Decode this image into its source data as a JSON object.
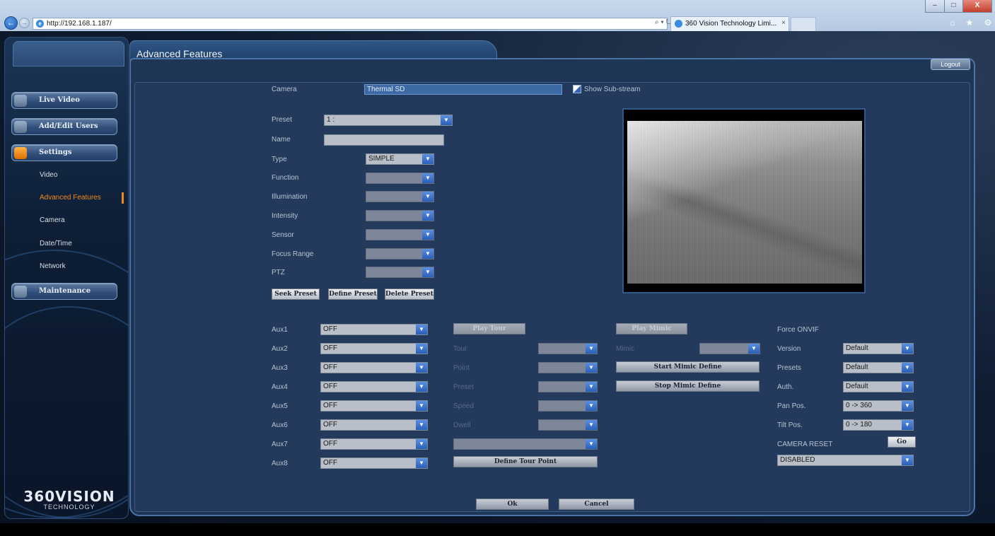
{
  "browser": {
    "url": "http://192.168.1.187/",
    "search_controls": "⌕ ▾ ↻",
    "tab_title": "360 Vision Technology Limi...",
    "tab_close": "×",
    "window_buttons": {
      "min": "–",
      "max": "□",
      "close": "X"
    },
    "toolbar_icons": "⌂ ★ ⚙"
  },
  "sidebar": {
    "menu": [
      {
        "label": "Live Video",
        "icon": "camera-icon"
      },
      {
        "label": "Add/Edit Users",
        "icon": "users-icon"
      },
      {
        "label": "Settings",
        "icon": "settings-icon"
      },
      {
        "label": "Maintenance",
        "icon": "maintenance-icon"
      }
    ],
    "settings_items": [
      "Video",
      "Advanced Features",
      "Camera",
      "Date/Time",
      "Network"
    ],
    "active_item": "Advanced Features",
    "logo_main": "360VISION",
    "logo_sub": "TECHNOLOGY"
  },
  "header": {
    "title": "Advanced Features",
    "logout": "Logout"
  },
  "camera": {
    "label": "Camera",
    "value": "Thermal SD",
    "substream_label": "Show Sub-stream"
  },
  "preset": {
    "preset_label": "Preset",
    "preset_value": "1 :",
    "name_label": "Name",
    "name_value": "",
    "type_label": "Type",
    "type_value": "SIMPLE",
    "function_label": "Function",
    "illumination_label": "Illumination",
    "intensity_label": "Intensity",
    "sensor_label": "Sensor",
    "focus_label": "Focus Range",
    "ptz_label": "PTZ",
    "seek": "Seek Preset",
    "define": "Define Preset",
    "delete": "Delete Preset"
  },
  "aux": [
    {
      "label": "Aux1",
      "value": "OFF"
    },
    {
      "label": "Aux2",
      "value": "OFF"
    },
    {
      "label": "Aux3",
      "value": "OFF"
    },
    {
      "label": "Aux4",
      "value": "OFF"
    },
    {
      "label": "Aux5",
      "value": "OFF"
    },
    {
      "label": "Aux6",
      "value": "OFF"
    },
    {
      "label": "Aux7",
      "value": "OFF"
    },
    {
      "label": "Aux8",
      "value": "OFF"
    }
  ],
  "tour": {
    "play": "Play Tour",
    "tour_label": "Tour",
    "point_label": "Point",
    "preset_label": "Preset",
    "speed_label": "Speed",
    "dwell_label": "Dwell",
    "define_point": "Define Tour Point"
  },
  "mimic": {
    "play": "Play Mimic",
    "mimic_label": "Mimic",
    "start": "Start Mimic Define",
    "stop": "Stop Mimic Define"
  },
  "onvif": {
    "title": "Force ONVIF",
    "version_label": "Version",
    "version_value": "Default",
    "presets_label": "Presets",
    "presets_value": "Default",
    "auth_label": "Auth.",
    "auth_value": "Default",
    "pan_label": "Pan Pos.",
    "pan_value": "0 -> 360",
    "tilt_label": "Tilt Pos.",
    "tilt_value": "0 -> 180",
    "reset_label": "CAMERA RESET",
    "go": "Go",
    "reset_value": "DISABLED"
  },
  "footer": {
    "ok": "Ok",
    "cancel": "Cancel"
  },
  "colors": {
    "accent": "#f08a1c",
    "panel": "#243a5c",
    "dropdown_arrow": "#2a5fb8"
  }
}
